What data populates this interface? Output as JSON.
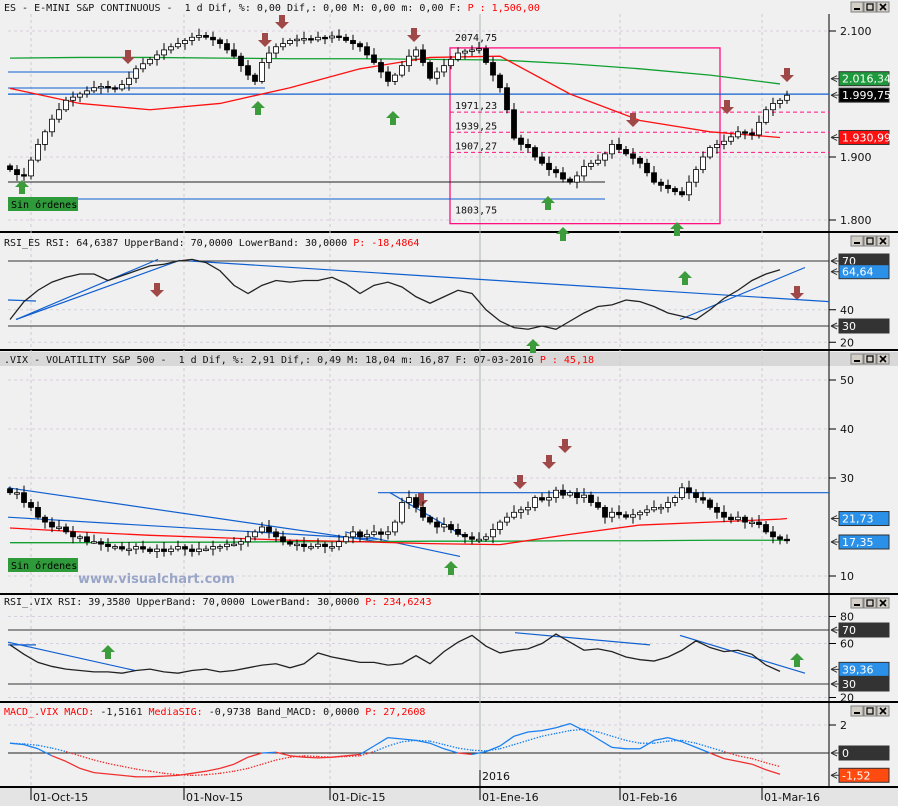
{
  "es_pane": {
    "header": "ES - E-MINI S&P CONTINUOUS -  1 d Dif, %: 0,00 Dif,: 0,00 M: 0,00 m: 0,00 F: ",
    "header_p": "P : 1,506,00",
    "axis_labels": [
      "2.100",
      "1.900",
      "1.800"
    ],
    "price_tags": [
      {
        "label": "2.016,34",
        "color": "#1e9a3c"
      },
      {
        "label": "1.999,75",
        "color": "#000000"
      },
      {
        "label": "1.930,99",
        "color": "#ff1010"
      }
    ],
    "levels": [
      "2074,75",
      "1971,23",
      "1939,25",
      "1907,27",
      "1803,75"
    ],
    "orders_label": "Sin órdenes"
  },
  "rsi_es_pane": {
    "header": "RSI_ES RSI: 64,6387 UpperBand: 70,0000 LowerBand: 30,0000 ",
    "header_p": "P: -18,4864",
    "axis_labels": [
      "40",
      "20"
    ],
    "tags": [
      {
        "label": "70",
        "color": "#333333"
      },
      {
        "label": "64,64",
        "color": "#2a90e8"
      },
      {
        "label": "30",
        "color": "#333333"
      }
    ]
  },
  "vix_pane": {
    "header": ".VIX - VOLATILITY S&P 500 -  1 d Dif, %: 2,91 Dif,: 0,49 M: 18,04 m: 16,87 F: 07-03-2016 ",
    "header_p": "P : 45,18",
    "axis_labels": [
      "50",
      "40",
      "30",
      "10"
    ],
    "tags": [
      {
        "label": "21,73",
        "color": "#2a90e8"
      },
      {
        "label": "17,35",
        "color": "#2a90e8"
      }
    ],
    "orders_label": "Sin órdenes",
    "watermark": "www.visualchart.com"
  },
  "rsi_vix_pane": {
    "header": "RSI_.VIX RSI: 39,3580 UpperBand: 70,0000 LowerBand: 30,0000 ",
    "header_p": "P: 234,6243",
    "axis_labels": [
      "80",
      "60",
      "20"
    ],
    "tags": [
      {
        "label": "70",
        "color": "#333333"
      },
      {
        "label": "39,36",
        "color": "#2a90e8"
      },
      {
        "label": "30",
        "color": "#333333"
      }
    ]
  },
  "macd_pane": {
    "h1": "MACD_.VIX MACD:",
    "h2": " -1,5161 ",
    "h3": "MediaSIG:",
    "h4": " -0,9738 Band_MACD: 0,0000 ",
    "h5": "P: 27,2608",
    "axis_labels": [
      "2"
    ],
    "tags": [
      {
        "label": "0",
        "color": "#333333"
      },
      {
        "label": "-1,52",
        "color": "#ff4a10"
      }
    ],
    "year_label": "2016"
  },
  "x_axis": {
    "labels": [
      "01-Oct-15",
      "01-Nov-15",
      "01-Dic-15",
      "01-Ene-16",
      "01-Feb-16",
      "01-Mar-16"
    ]
  },
  "colors": {
    "up_arrow": "#3c9c3c",
    "down_arrow": "#a04848",
    "ma_fast": "#ff1010",
    "ma_slow": "#10a030",
    "trend": "#1060d0",
    "box": "#ff1080"
  },
  "chart_data": [
    {
      "type": "candlestick",
      "title": "ES - E-MINI S&P CONTINUOUS",
      "ylim": [
        1780,
        2130
      ],
      "closes": [
        1880,
        1872,
        1870,
        1895,
        1920,
        1940,
        1960,
        1975,
        1990,
        1995,
        2000,
        2005,
        2010,
        2012,
        2010,
        2008,
        2015,
        2025,
        2040,
        2048,
        2055,
        2062,
        2070,
        2075,
        2080,
        2085,
        2090,
        2093,
        2090,
        2086,
        2080,
        2070,
        2060,
        2045,
        2030,
        2020,
        2050,
        2065,
        2075,
        2080,
        2085,
        2087,
        2088,
        2086,
        2090,
        2089,
        2092,
        2090,
        2085,
        2080,
        2075,
        2062,
        2050,
        2035,
        2020,
        2030,
        2045,
        2060,
        2070,
        2050,
        2025,
        2035,
        2045,
        2055,
        2065,
        2068,
        2070,
        2072,
        2050,
        2030,
        2010,
        1975,
        1930,
        1920,
        1915,
        1900,
        1890,
        1880,
        1875,
        1865,
        1860,
        1870,
        1885,
        1890,
        1895,
        1905,
        1920,
        1912,
        1905,
        1898,
        1890,
        1875,
        1860,
        1855,
        1850,
        1845,
        1840,
        1860,
        1880,
        1900,
        1915,
        1920,
        1925,
        1932,
        1940,
        1938,
        1935,
        1955,
        1975,
        1985,
        1990,
        1998
      ],
      "ma_fast_every10": [
        2009,
        1985,
        1975,
        1985,
        2010,
        2040,
        2058,
        2060,
        2000,
        1958,
        1940,
        1931
      ],
      "ma_slow_every10": [
        2057,
        2058,
        2058,
        2057,
        2056,
        2056,
        2055,
        2054,
        2048,
        2040,
        2030,
        2016
      ],
      "levels": [
        2074.75,
        1971.23,
        1939.25,
        1907.27,
        1803.75,
        1999.75
      ]
    },
    {
      "type": "line",
      "title": "RSI_ES",
      "ylim": [
        15,
        80
      ],
      "bands": [
        70,
        30
      ],
      "values_every2": [
        34,
        45,
        52,
        57,
        60,
        62,
        62,
        58,
        61,
        64,
        67,
        68,
        70,
        71,
        69,
        64,
        55,
        50,
        55,
        58,
        57,
        58,
        58,
        60,
        56,
        50,
        55,
        57,
        54,
        48,
        44,
        48,
        52,
        50,
        40,
        33,
        29,
        28,
        30,
        28,
        33,
        38,
        42,
        43,
        46,
        45,
        42,
        38,
        36,
        34,
        40,
        47,
        52,
        58,
        62,
        64.64
      ]
    },
    {
      "type": "candlestick",
      "title": ".VIX - VOLATILITY S&P 500",
      "ylim": [
        7,
        53
      ],
      "closes": [
        27,
        27,
        25,
        24,
        22,
        21,
        20,
        20,
        19,
        18,
        18,
        17,
        17,
        16.5,
        16,
        16,
        15.5,
        15.5,
        16,
        15.5,
        15,
        15.5,
        15,
        15.5,
        16,
        15.5,
        15,
        15.5,
        15.5,
        16,
        16,
        16.5,
        16.5,
        17,
        18,
        19,
        20,
        19,
        18,
        17,
        16.5,
        16.5,
        16,
        16,
        16.5,
        16,
        16,
        17,
        18,
        19,
        18,
        18.5,
        19,
        18.5,
        19,
        21,
        25,
        26,
        24,
        22,
        21,
        20,
        20.5,
        19.5,
        18.5,
        18,
        17.5,
        17.5,
        18,
        19.5,
        21,
        22,
        23,
        23.5,
        24,
        26,
        25.5,
        26,
        27.5,
        26.5,
        27,
        26,
        26.5,
        25,
        24,
        22,
        23,
        22.5,
        22,
        22.5,
        23,
        23.5,
        24,
        24,
        25,
        26,
        28,
        27,
        26,
        25.5,
        24,
        23,
        22,
        21.5,
        22,
        21,
        21,
        20.5,
        19,
        18,
        17.5,
        17.35
      ],
      "ma_fast_every10": [
        19.8,
        19.0,
        18.3,
        17.8,
        17.3,
        17.0,
        16.6,
        16.4,
        18.5,
        20.4,
        21.0,
        21.6,
        21.73
      ],
      "ma_slow_every10": [
        16.8,
        16.8,
        16.9,
        16.9,
        17.0,
        17.0,
        17.1,
        17.1,
        17.2,
        17.2,
        17.3,
        17.3,
        17.35
      ]
    },
    {
      "type": "line",
      "title": "RSI_.VIX",
      "ylim": [
        15,
        85
      ],
      "bands": [
        70,
        30
      ],
      "values_every2": [
        59,
        52,
        46,
        43,
        41,
        40,
        39,
        39,
        38,
        40,
        41,
        39,
        38,
        40,
        41,
        39,
        40,
        42,
        44,
        45,
        42,
        45,
        53,
        50,
        48,
        46,
        46,
        44,
        45,
        51,
        45,
        54,
        61,
        66,
        58,
        53,
        55,
        56,
        60,
        67,
        61,
        55,
        56,
        54,
        50,
        48,
        47,
        50,
        55,
        62,
        57,
        54,
        55,
        52,
        44,
        39.36
      ]
    },
    {
      "type": "line",
      "title": "MACD_.VIX",
      "ylim": [
        -2.5,
        2.5
      ],
      "macd_every2": [
        0.7,
        0.6,
        0.3,
        -0.2,
        -0.6,
        -1.1,
        -1.4,
        -1.5,
        -1.6,
        -1.7,
        -1.7,
        -1.65,
        -1.6,
        -1.45,
        -1.3,
        -1.1,
        -0.8,
        -0.3,
        0,
        0.05,
        -0.2,
        -0.3,
        -0.35,
        -0.3,
        -0.2,
        -0.1,
        0.5,
        1.1,
        1.0,
        0.9,
        0.7,
        0.3,
        0,
        -0.1,
        0.1,
        0.5,
        1.2,
        1.5,
        1.6,
        1.8,
        2.1,
        1.6,
        1.0,
        0.4,
        0.3,
        0.3,
        0.9,
        1.1,
        0.8,
        0.4,
        0,
        -0.4,
        -0.6,
        -0.8,
        -1.2,
        -1.52
      ],
      "signal_every2": [
        0.7,
        0.65,
        0.55,
        0.35,
        0.1,
        -0.2,
        -0.5,
        -0.75,
        -0.95,
        -1.15,
        -1.3,
        -1.45,
        -1.55,
        -1.6,
        -1.55,
        -1.45,
        -1.3,
        -1.1,
        -0.8,
        -0.5,
        -0.3,
        -0.2,
        -0.25,
        -0.3,
        -0.25,
        -0.2,
        0.1,
        0.5,
        0.8,
        0.9,
        0.85,
        0.6,
        0.35,
        0.2,
        0.15,
        0.3,
        0.6,
        0.9,
        1.2,
        1.4,
        1.6,
        1.7,
        1.5,
        1.2,
        0.9,
        0.7,
        0.7,
        0.85,
        0.9,
        0.7,
        0.4,
        0.1,
        -0.2,
        -0.4,
        -0.7,
        -0.97
      ]
    }
  ]
}
